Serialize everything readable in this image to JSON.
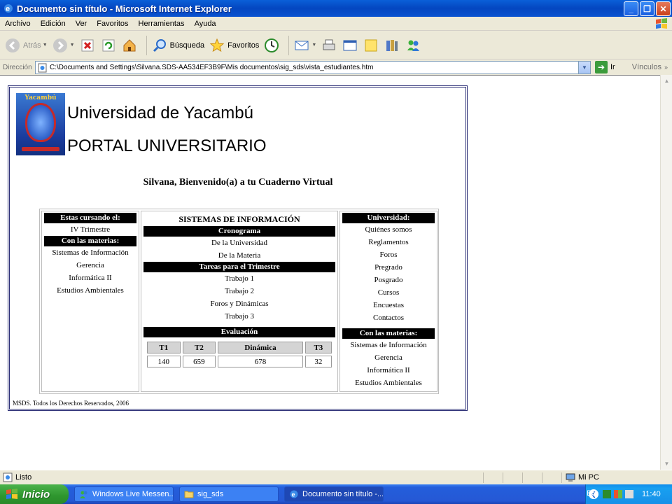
{
  "window": {
    "title": "Documento sin título - Microsoft Internet Explorer",
    "buttons": [
      "_",
      "❐",
      "✕"
    ]
  },
  "menu": [
    "Archivo",
    "Edición",
    "Ver",
    "Favoritos",
    "Herramientas",
    "Ayuda"
  ],
  "toolbar": {
    "back_label": "Atrás",
    "search_label": "Búsqueda",
    "favorites_label": "Favoritos"
  },
  "address": {
    "label": "Dirección",
    "url": "C:\\Documents and Settings\\Silvana.SDS-AA534EF3B9F\\Mis documentos\\sig_sds\\vista_estudiantes.htm",
    "go_label": "Ir",
    "links_label": "Vínculos"
  },
  "page": {
    "logo_banner": "Yacambú",
    "university": "Universidad de Yacambú",
    "portal": "PORTAL UNIVERSITARIO",
    "welcome": "Silvana, Bienvenido(a) a tu Cuaderno Virtual",
    "left": {
      "cursando_header": "Estas cursando el:",
      "trimestre": "IV Trimestre",
      "materias_header": "Con las materias:",
      "materias": [
        "Sistemas de Información",
        "Gerencia",
        "Informática II",
        "Estudios Ambientales"
      ]
    },
    "middle": {
      "title": "SISTEMAS DE INFORMACIÓN",
      "cronograma_header": "Cronograma",
      "cronograma": [
        "De la Universidad",
        "De la Materia"
      ],
      "tareas_header": "Tareas para el Trimestre",
      "tareas": [
        "Trabajo 1",
        "Trabajo 2",
        "Foros y Dinámicas",
        "Trabajo 3"
      ],
      "evaluacion_header": "Evaluación",
      "eval_columns": [
        "T1",
        "T2",
        "Dinámica",
        "T3"
      ],
      "eval_values": [
        "140",
        "659",
        "678",
        "32"
      ]
    },
    "right": {
      "universidad_header": "Universidad:",
      "universidad_links": [
        "Quiénes somos",
        "Reglamentos",
        "Foros",
        "Pregrado",
        "Posgrado",
        "Cursos",
        "Encuestas",
        "Contactos"
      ],
      "materias_header": "Con las materias:",
      "materias": [
        "Sistemas de Información",
        "Gerencia",
        "Informática II",
        "Estudios Ambientales"
      ]
    },
    "copyright": "MSDS. Todos los Derechos Reservados, 2006"
  },
  "status": {
    "text": "Listo",
    "zone": "Mi PC"
  },
  "taskbar": {
    "start": "Inicio",
    "tasks": [
      "Windows Live Messen...",
      "sig_sds",
      "Documento sin título -..."
    ],
    "lang": "ES",
    "clock": "11:40"
  }
}
